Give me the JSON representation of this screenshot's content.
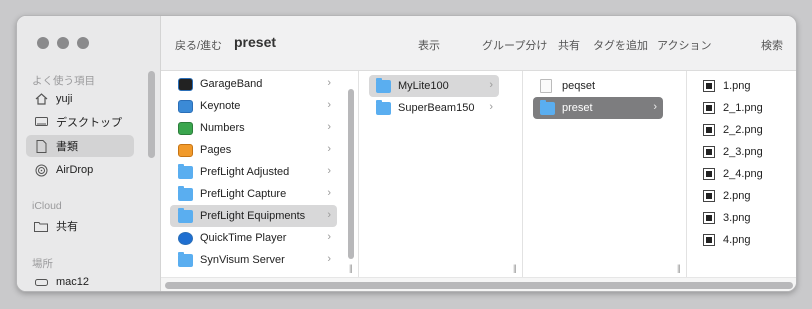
{
  "window": {
    "traffic_lights": [
      "close",
      "minimize",
      "zoom"
    ]
  },
  "toolbar": {
    "back_forward": "戻る/進む",
    "title": "preset",
    "view": "表示",
    "group": "グループ分け",
    "share": "共有",
    "add_tag": "タグを追加",
    "action": "アクション",
    "search": "検索"
  },
  "sidebar": {
    "favorites_header": "よく使う項目",
    "favorites": [
      {
        "label": "yuji",
        "icon": "home-icon"
      },
      {
        "label": "デスクトップ",
        "icon": "desktop-icon"
      },
      {
        "label": "書類",
        "icon": "document-icon",
        "selected": true
      },
      {
        "label": "AirDrop",
        "icon": "airdrop-icon"
      }
    ],
    "icloud_header": "iCloud",
    "icloud": [
      {
        "label": "共有",
        "icon": "shared-folder-icon"
      }
    ],
    "locations_header": "場所",
    "locations": [
      {
        "label": "mac12",
        "icon": "drive-icon"
      }
    ]
  },
  "columns": {
    "col1": [
      {
        "label": "GarageBand",
        "chev": "›"
      },
      {
        "label": "Keynote",
        "chev": "›"
      },
      {
        "label": "Numbers",
        "chev": "›"
      },
      {
        "label": "Pages",
        "chev": "›"
      },
      {
        "label": "PrefLight Adjusted",
        "chev": "›"
      },
      {
        "label": "PrefLight Capture",
        "chev": "›"
      },
      {
        "label": "PrefLight Equipments",
        "chev": "›",
        "selected": true
      },
      {
        "label": "QuickTime Player",
        "chev": "›"
      },
      {
        "label": "SynVisum Server",
        "chev": "›"
      }
    ],
    "col2": [
      {
        "label": "MyLite100",
        "chev": "›",
        "selected": true
      },
      {
        "label": "SuperBeam150",
        "chev": "›"
      }
    ],
    "col3": [
      {
        "label": "peqset",
        "chev": ""
      },
      {
        "label": "preset",
        "chev": "›",
        "selected": true
      }
    ],
    "col4": [
      {
        "label": "1.png"
      },
      {
        "label": "2_1.png"
      },
      {
        "label": "2_2.png"
      },
      {
        "label": "2_3.png"
      },
      {
        "label": "2_4.png"
      },
      {
        "label": "2.png"
      },
      {
        "label": "3.png"
      },
      {
        "label": "4.png"
      }
    ]
  },
  "column_resize_grip": "||"
}
